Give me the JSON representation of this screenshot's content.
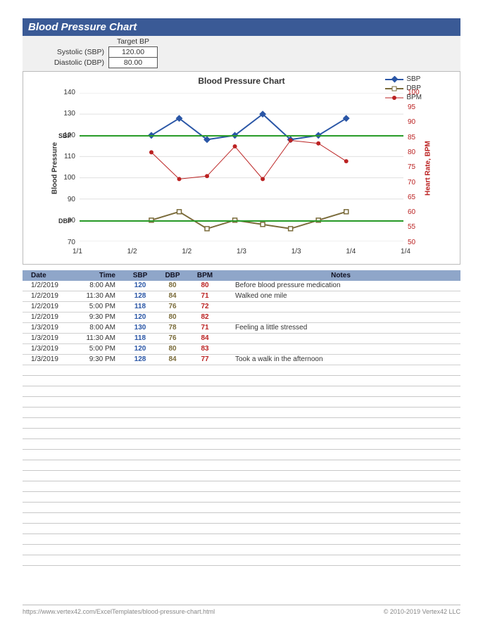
{
  "header": {
    "title": "Blood Pressure Chart"
  },
  "targets": {
    "header": "Target BP",
    "systolic_label": "Systolic (SBP)",
    "diastolic_label": "Diastolic (DBP)",
    "systolic_value": "120.00",
    "diastolic_value": "80.00"
  },
  "chart": {
    "title": "Blood Pressure Chart",
    "ylabel_left": "Blood Pressure",
    "ylabel_right": "Heart Rate, BPM",
    "legend": {
      "sbp": "SBP",
      "dbp": "DBP",
      "bpm": "BPM"
    },
    "x_ticks": [
      "1/1",
      "1/2",
      "1/2",
      "1/3",
      "1/3",
      "1/4",
      "1/4"
    ],
    "y_left_ticks": [
      "140",
      "130",
      "120",
      "110",
      "100",
      "90",
      "80",
      "70"
    ],
    "y_right_ticks": [
      "100",
      "95",
      "90",
      "85",
      "80",
      "75",
      "70",
      "65",
      "60",
      "55",
      "50"
    ],
    "sbp_target_label": "SBP",
    "dbp_target_label": "DBP"
  },
  "table": {
    "headers": {
      "date": "Date",
      "time": "Time",
      "sbp": "SBP",
      "dbp": "DBP",
      "bpm": "BPM",
      "notes": "Notes"
    },
    "rows": [
      {
        "date": "1/2/2019",
        "time": "8:00 AM",
        "sbp": "120",
        "dbp": "80",
        "bpm": "80",
        "notes": "Before blood pressure medication"
      },
      {
        "date": "1/2/2019",
        "time": "11:30 AM",
        "sbp": "128",
        "dbp": "84",
        "bpm": "71",
        "notes": "Walked one mile"
      },
      {
        "date": "1/2/2019",
        "time": "5:00 PM",
        "sbp": "118",
        "dbp": "76",
        "bpm": "72",
        "notes": ""
      },
      {
        "date": "1/2/2019",
        "time": "9:30 PM",
        "sbp": "120",
        "dbp": "80",
        "bpm": "82",
        "notes": ""
      },
      {
        "date": "1/3/2019",
        "time": "8:00 AM",
        "sbp": "130",
        "dbp": "78",
        "bpm": "71",
        "notes": "Feeling a little stressed"
      },
      {
        "date": "1/3/2019",
        "time": "11:30 AM",
        "sbp": "118",
        "dbp": "76",
        "bpm": "84",
        "notes": ""
      },
      {
        "date": "1/3/2019",
        "time": "5:00 PM",
        "sbp": "120",
        "dbp": "80",
        "bpm": "83",
        "notes": ""
      },
      {
        "date": "1/3/2019",
        "time": "9:30 PM",
        "sbp": "128",
        "dbp": "84",
        "bpm": "77",
        "notes": "Took a walk in the afternoon"
      }
    ],
    "blank_row_count": 19
  },
  "footer": {
    "url": "https://www.vertex42.com/ExcelTemplates/blood-pressure-chart.html",
    "copyright": "© 2010-2019 Vertex42 LLC"
  },
  "chart_data": {
    "type": "line",
    "title": "Blood Pressure Chart",
    "xlabel": "",
    "ylabel_left": "Blood Pressure",
    "ylabel_right": "Heart Rate, BPM",
    "y_left_range": [
      70,
      140
    ],
    "y_right_range": [
      50,
      100
    ],
    "x_range": [
      "1/1",
      "1/4"
    ],
    "x": [
      "1/2 8:00",
      "1/2 11:30",
      "1/2 17:00",
      "1/2 21:30",
      "1/3 8:00",
      "1/3 11:30",
      "1/3 17:00",
      "1/3 21:30"
    ],
    "series": [
      {
        "name": "SBP",
        "axis": "left",
        "color": "#2a56a6",
        "marker": "diamond",
        "values": [
          120,
          128,
          118,
          120,
          130,
          118,
          120,
          128
        ]
      },
      {
        "name": "DBP",
        "axis": "left",
        "color": "#7a6b3a",
        "marker": "square",
        "values": [
          80,
          84,
          76,
          80,
          78,
          76,
          80,
          84
        ]
      },
      {
        "name": "BPM",
        "axis": "right",
        "color": "#bb2222",
        "marker": "circle",
        "values": [
          80,
          71,
          72,
          82,
          71,
          84,
          83,
          77
        ]
      }
    ],
    "reference_lines": [
      {
        "name": "SBP target",
        "axis": "left",
        "value": 120,
        "color": "#2a9d2a"
      },
      {
        "name": "DBP target",
        "axis": "left",
        "value": 80,
        "color": "#2a9d2a"
      }
    ]
  }
}
